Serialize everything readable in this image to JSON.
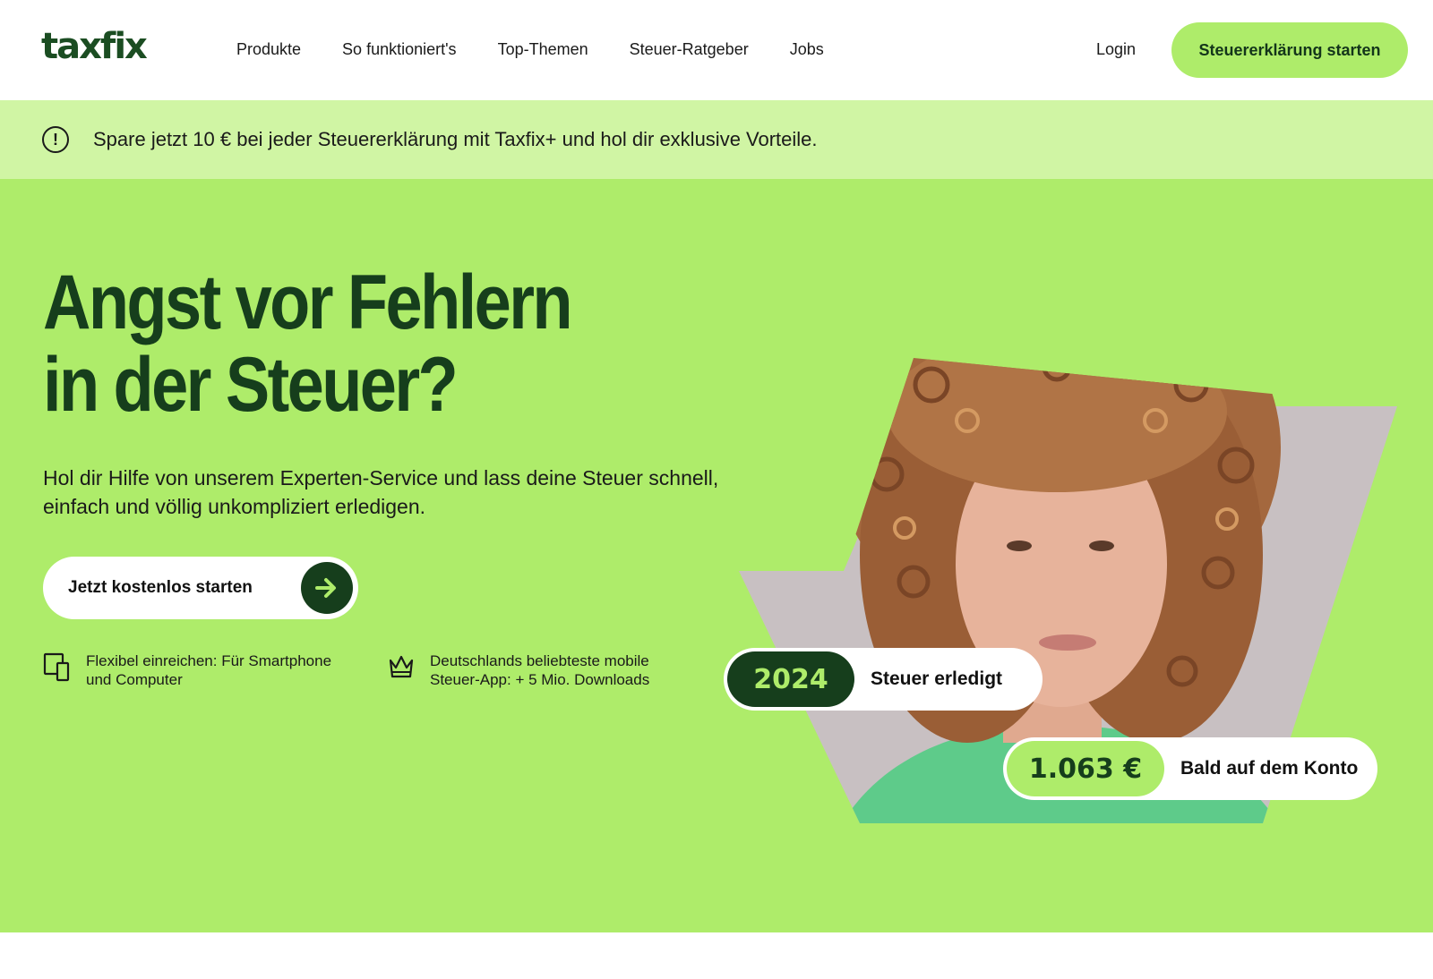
{
  "header": {
    "logo": "taxfix",
    "nav": [
      "Produkte",
      "So funktioniert's",
      "Top-Themen",
      "Steuer-Ratgeber",
      "Jobs"
    ],
    "login": "Login",
    "cta": "Steuererklärung starten"
  },
  "banner": {
    "icon": "info-exclamation-icon",
    "text": "Spare jetzt 10 € bei jeder Steuererklärung mit Taxfix+ und hol dir exklusive Vorteile."
  },
  "hero": {
    "headline_line1": "Angst vor Fehlern",
    "headline_line2": "in der Steuer?",
    "subtitle": "Hol dir Hilfe von unserem Experten-Service und lass deine Steuer schnell, einfach und völlig unkompliziert erledigen.",
    "cta": "Jetzt kostenlos starten",
    "features": [
      {
        "icon": "devices-icon",
        "text": "Flexibel einreichen: Für Smartphone und Computer"
      },
      {
        "icon": "crown-icon",
        "text": "Deutschlands beliebteste mobile Steuer-App: + 5 Mio. Downloads"
      }
    ],
    "badge_year": {
      "value": "2024",
      "label": "Steuer erledigt"
    },
    "badge_amount": {
      "value": "1.063 €",
      "label": "Bald auf dem Konto"
    }
  },
  "colors": {
    "brand_dark": "#163e1c",
    "brand_green": "#aeec6a",
    "banner_green": "#d0f5a4"
  }
}
